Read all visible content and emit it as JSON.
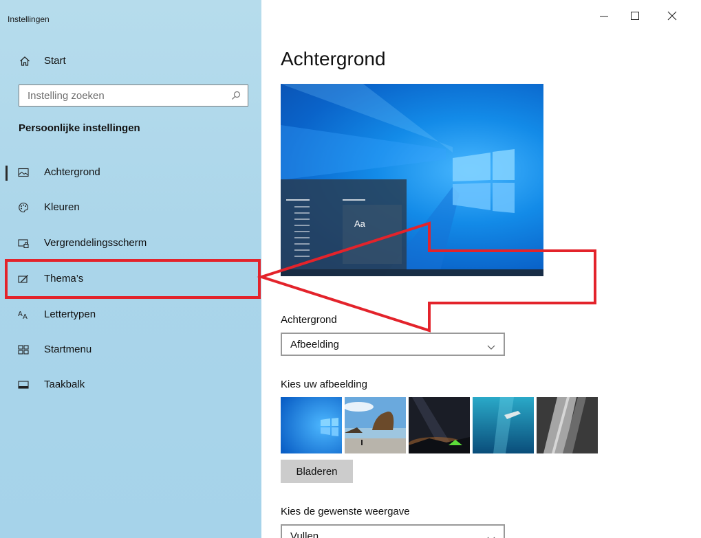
{
  "window": {
    "app_title": "Instellingen"
  },
  "sidebar": {
    "home_label": "Start",
    "search_placeholder": "Instelling zoeken",
    "section_title": "Persoonlijke instellingen",
    "items": [
      {
        "label": "Achtergrond",
        "icon": "picture-icon",
        "selected": true
      },
      {
        "label": "Kleuren",
        "icon": "palette-icon",
        "selected": false
      },
      {
        "label": "Vergrendelingsscherm",
        "icon": "lock-screen-icon",
        "selected": false
      },
      {
        "label": "Thema’s",
        "icon": "theme-brush-icon",
        "selected": false
      },
      {
        "label": "Lettertypen",
        "icon": "font-icon",
        "selected": false
      },
      {
        "label": "Startmenu",
        "icon": "start-menu-icon",
        "selected": false
      },
      {
        "label": "Taakbalk",
        "icon": "taskbar-icon",
        "selected": false
      }
    ]
  },
  "main": {
    "title": "Achtergrond",
    "preview_sample_text": "Aa",
    "background_label": "Achtergrond",
    "background_value": "Afbeelding",
    "choose_picture_label": "Kies uw afbeelding",
    "browse_label": "Bladeren",
    "fit_label": "Kies de gewenste weergave",
    "fit_value": "Vullen"
  },
  "colors": {
    "sidebar_bg": "#aad5ea",
    "highlight_red": "#e3232b",
    "preview_blue": "#138be8"
  }
}
